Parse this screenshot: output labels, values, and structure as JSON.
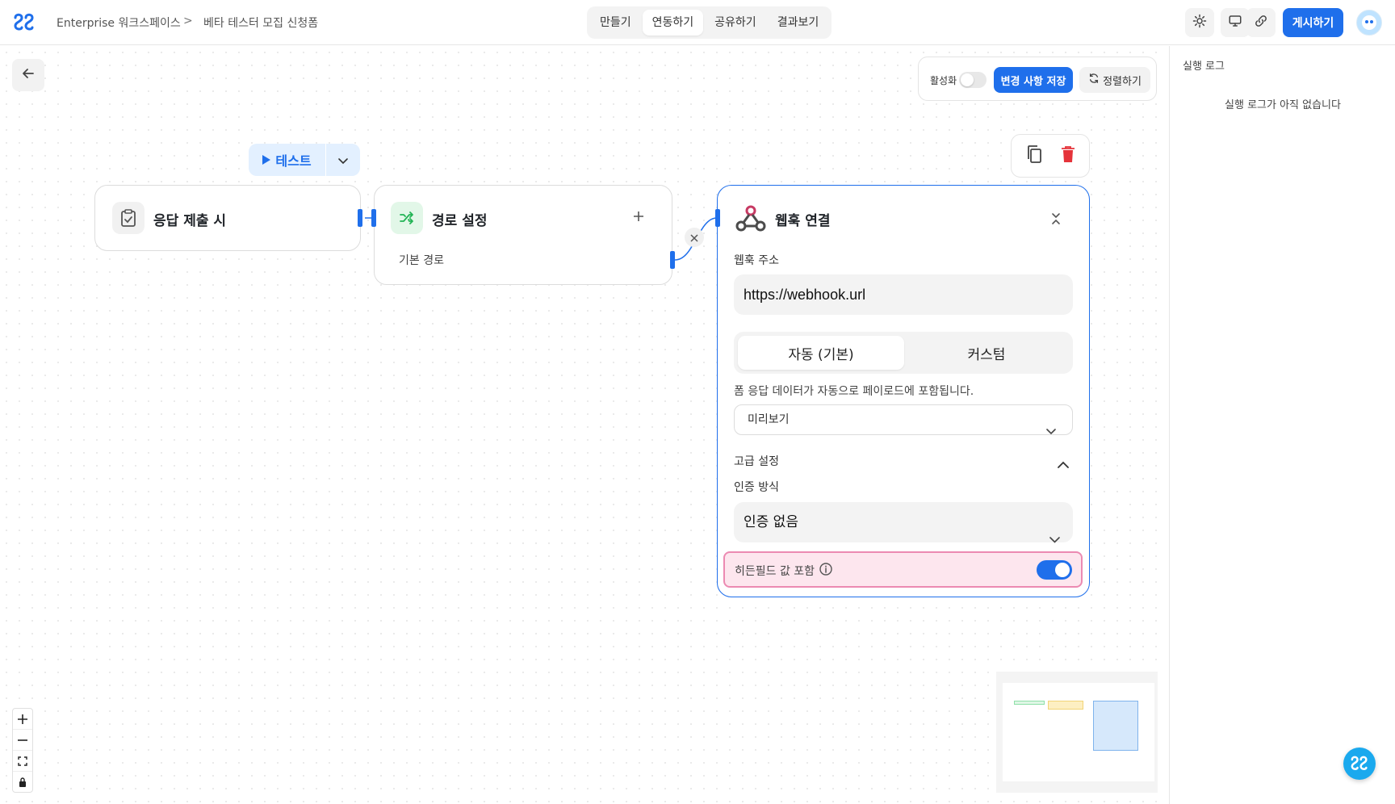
{
  "header": {
    "workspace": "Enterprise 워크스페이스",
    "separator": ">",
    "form_name": "베타 테스터 모집 신청폼",
    "tabs": [
      {
        "label": "만들기"
      },
      {
        "label": "연동하기"
      },
      {
        "label": "공유하기"
      },
      {
        "label": "결과보기"
      }
    ],
    "active_tab": "연동하기",
    "publish_label": "게시하기",
    "icons": [
      "gear-icon",
      "monitor-icon",
      "link-icon"
    ]
  },
  "toolbar": {
    "activate_label": "활성화",
    "activate_on": false,
    "save_label": "변경 사항 저장",
    "align_label": "정렬하기"
  },
  "test_button": {
    "label": "테스트"
  },
  "nodes": {
    "trigger": {
      "title": "응답 제출 시",
      "icon": "clipboard-check-icon"
    },
    "route": {
      "title": "경로 설정",
      "path_label": "기본 경로",
      "icon": "shuffle-icon"
    },
    "webhook": {
      "title": "웹훅 연결",
      "icon": "webhook-icon",
      "url_label": "웹훅 주소",
      "url_value": "https://webhook.url",
      "mode_options": [
        "자동 (기본)",
        "커스텀"
      ],
      "mode_selected": "자동 (기본)",
      "mode_description": "폼 응답 데이터가 자동으로 페이로드에 포함됩니다.",
      "preview_label": "미리보기",
      "advanced_label": "고급 설정",
      "auth_label": "인증 방식",
      "auth_value": "인증 없음",
      "hidden_fields_label": "히든필드 값 포함",
      "hidden_fields_on": true
    }
  },
  "log_panel": {
    "title": "실행 로그",
    "empty_message": "실행 로그가 아직 없습니다"
  },
  "colors": {
    "accent": "#1f6feb",
    "highlight_bg": "#fde6ee",
    "highlight_border": "#ec8ab2",
    "danger": "#e5333a",
    "route_green": "#22b455"
  }
}
